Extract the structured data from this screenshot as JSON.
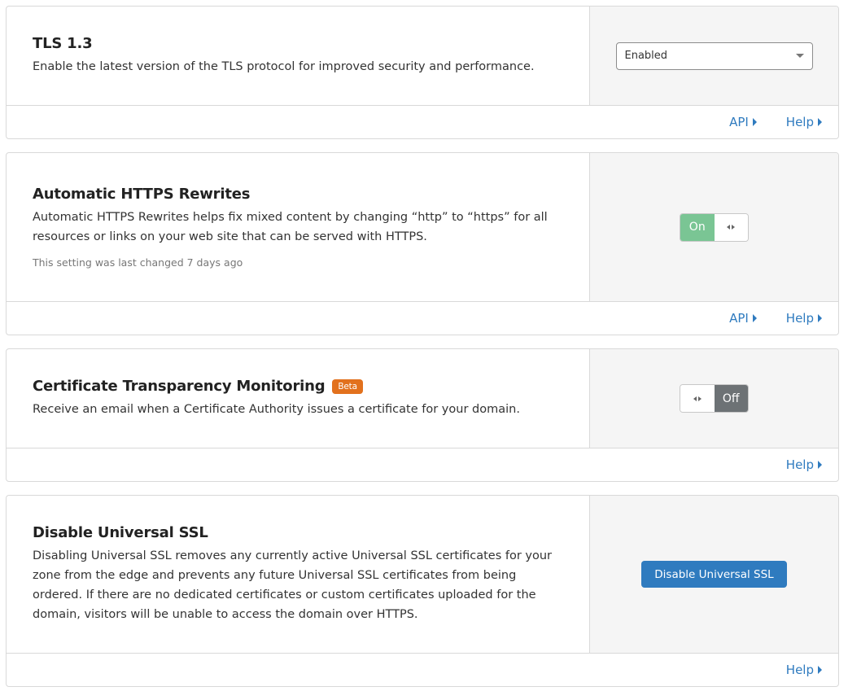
{
  "cards": [
    {
      "title": "TLS 1.3",
      "description": "Enable the latest version of the TLS protocol for improved security and performance.",
      "control": {
        "type": "select",
        "value": "Enabled"
      },
      "footer": {
        "api_label": "API",
        "help_label": "Help"
      }
    },
    {
      "title": "Automatic HTTPS Rewrites",
      "description": "Automatic HTTPS Rewrites helps fix mixed content by changing “http” to “https” for all resources or links on your web site that can be served with HTTPS.",
      "meta": "This setting was last changed 7 days ago",
      "control": {
        "type": "toggle",
        "state": "on",
        "label": "On"
      },
      "footer": {
        "api_label": "API",
        "help_label": "Help"
      }
    },
    {
      "title": "Certificate Transparency Monitoring",
      "badge": "Beta",
      "description": "Receive an email when a Certificate Authority issues a certificate for your domain.",
      "control": {
        "type": "toggle",
        "state": "off",
        "label": "Off"
      },
      "footer": {
        "help_label": "Help"
      }
    },
    {
      "title": "Disable Universal SSL",
      "description": "Disabling Universal SSL removes any currently active Universal SSL certificates for your zone from the edge and prevents any future Universal SSL certificates from being ordered. If there are no dedicated certificates or custom certificates uploaded for the domain, visitors will be unable to access the domain over HTTPS.",
      "control": {
        "type": "button",
        "label": "Disable Universal SSL"
      },
      "footer": {
        "help_label": "Help"
      }
    }
  ],
  "colors": {
    "link": "#2f7bbf",
    "toggle_on": "#7ac594",
    "toggle_off": "#6d7275",
    "badge": "#e2711d",
    "primary_button": "#2f7bbf",
    "control_panel_bg": "#f5f5f5"
  }
}
